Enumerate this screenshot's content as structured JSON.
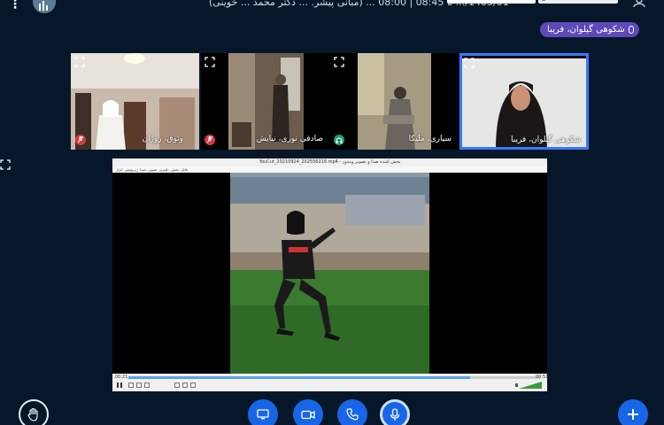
{
  "topbar": {
    "meeting_info": "(مبانی پیشر. ... دکتر محمد ... خوینی) ... 1405/01/... تا 08:45 | 08:00",
    "date": "1405/01/",
    "time_range": "08:45 تا 08:00"
  },
  "talking": {
    "label": "شکوهی گیلوان، فریبا"
  },
  "participants": [
    {
      "name": "وثوق، روژان",
      "muted": true
    },
    {
      "name": "صادقی نوری، نیایش",
      "muted": true
    },
    {
      "name": "سیاری، ملیکا",
      "muted": false,
      "status": "headset"
    },
    {
      "name": "شکوهی گیلوان، فریبا",
      "muted": false,
      "status": "talking"
    }
  ],
  "video_player": {
    "title": "YouCut_20210924_202556218.mp4 - پخش کننده صدا و تصویر ویندوز",
    "menu": [
      "فایل",
      "پخش",
      "ناوبری",
      "تصویر",
      "صدا",
      "زیرنویس",
      "ابزار"
    ],
    "time_elapsed": "00:21",
    "time_total": "00:51",
    "progress": 0.83
  },
  "controls": {
    "share_screen": "share-screen",
    "camera": "camera",
    "phone": "phone",
    "mic": "microphone",
    "raise_hand": "raise-hand",
    "add": "add"
  },
  "colors": {
    "background": "#06172a",
    "accent": "#1766e8",
    "talking_pill": "#5e49b8",
    "muted": "#d83b3b",
    "active_border": "#3a78ff"
  }
}
